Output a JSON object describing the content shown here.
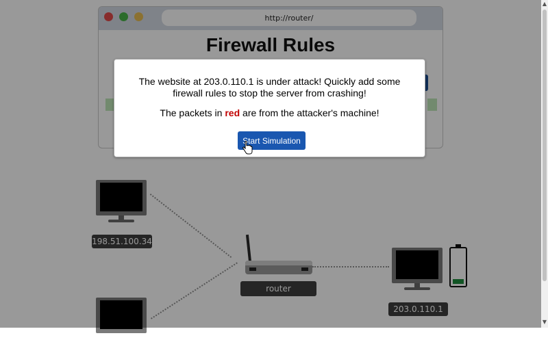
{
  "browser": {
    "url": "http://router/",
    "title": "Firewall Rules"
  },
  "network": {
    "hosts": [
      {
        "ip": "198.51.100.34"
      },
      {
        "ip": "203.0.110.1"
      }
    ],
    "router_label": "router",
    "server_battery_level": 0.15
  },
  "dialog": {
    "message_line1": "The website at 203.0.110.1 is under attack! Quickly add some firewall rules to stop the server from crashing!",
    "message2_prefix": "The packets in ",
    "message2_highlight": "red",
    "message2_suffix": " are from the attacker's machine!",
    "button_label": "Start Simulation"
  },
  "colors": {
    "attacker_highlight": "#c00000",
    "button": "#1a57b0"
  }
}
